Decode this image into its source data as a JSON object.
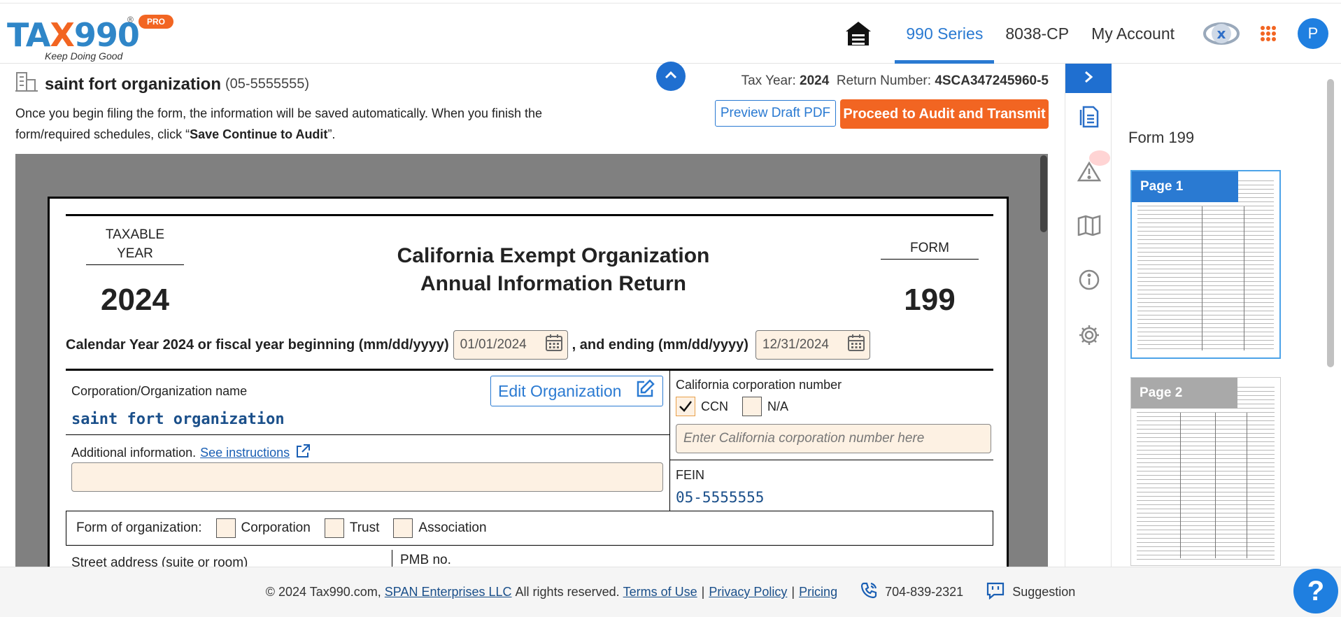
{
  "brand": {
    "name_prefix": "TA",
    "name_x": "X",
    "name_suffix": "990",
    "registered": "®",
    "badge": "PRO",
    "tagline": "Keep Doing Good",
    "accent": "#f26522",
    "primary": "#2f86c8"
  },
  "nav": {
    "items": [
      "990 Series",
      "8038-CP",
      "My Account"
    ],
    "active": "990 Series",
    "avatar_initial": "P"
  },
  "org": {
    "name": "saint fort organization",
    "ein_display": "(05-5555555)"
  },
  "info": {
    "text_before": "Once you begin filing the form, the information will be saved automatically. When you finish the form/required schedules, click “",
    "text_bold": "Save Continue to Audit",
    "text_after": "”."
  },
  "return_meta": {
    "tax_year_label": "Tax Year:",
    "tax_year": "2024",
    "return_number_label": "Return Number:",
    "return_number": "4SCA347245960-5"
  },
  "actions": {
    "preview": "Preview Draft PDF",
    "proceed": "Proceed to Audit and Transmit"
  },
  "form": {
    "taxable_year_label": "TAXABLE YEAR",
    "year": "2024",
    "title_line1": "California Exempt Organization",
    "title_line2": "Annual Information Return",
    "form_label": "FORM",
    "form_number": "199",
    "cal_text": "Calendar Year 2024 or fiscal year beginning (mm/dd/yyyy)",
    "begin_date": "01/01/2024",
    "ending_text": ", and ending (mm/dd/yyyy)",
    "end_date": "12/31/2024",
    "corp_label": "Corporation/Organization name",
    "edit_org": "Edit Organization",
    "corp_name": "saint fort organization",
    "additional_label": "Additional information.",
    "see_instructions": "See instructions",
    "ccn_label": "California corporation number",
    "ccn_option": "CCN",
    "na_option": "N/A",
    "ccn_placeholder": "Enter California corporation number here",
    "fein_label": "FEIN",
    "fein_value": "05-5555555",
    "form_of_org_label": "Form of organization:",
    "org_types": [
      "Corporation",
      "Trust",
      "Association"
    ],
    "street_label": "Street address (suite or room)",
    "pmb_label": "PMB no."
  },
  "thumbnails": {
    "title": "Form 199",
    "pages": [
      "Page 1",
      "Page 2"
    ]
  },
  "footer": {
    "copyright": "© 2024 Tax990.com,",
    "company": "SPAN Enterprises LLC",
    "rights": "All rights reserved.",
    "terms": "Terms of Use",
    "privacy": "Privacy Policy",
    "pricing": "Pricing",
    "phone": "704-839-2321",
    "suggestion": "Suggestion",
    "help": "?"
  }
}
